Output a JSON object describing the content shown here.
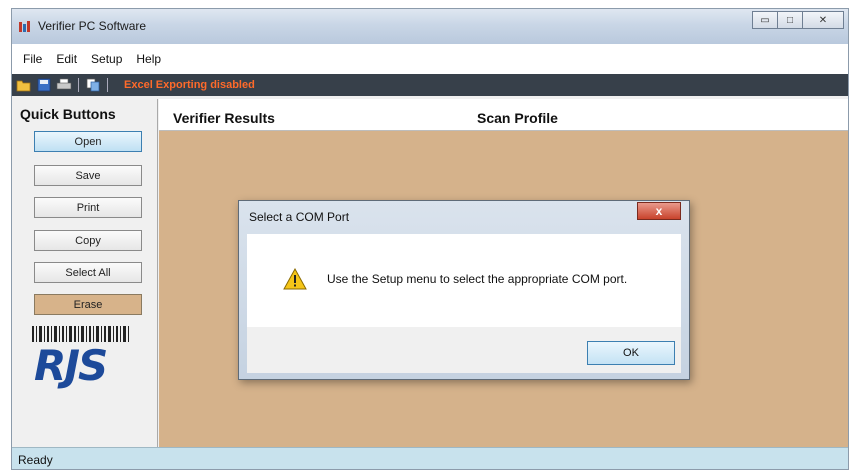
{
  "window": {
    "title": "Verifier PC Software",
    "minimize_glyph": "▭",
    "maximize_glyph": "□",
    "close_glyph": "✕"
  },
  "menu": {
    "items": [
      "File",
      "Edit",
      "Setup",
      "Help"
    ]
  },
  "toolbar": {
    "icons": [
      "open-folder-icon",
      "save-icon",
      "print-icon",
      "copy-icon"
    ],
    "status": "Excel Exporting disabled",
    "status_color": "#ff6a2a"
  },
  "quick_panel": {
    "title": "Quick Buttons",
    "buttons": [
      "Open",
      "Save",
      "Print",
      "Copy",
      "Select All",
      "Erase"
    ],
    "logo_text": "RJS",
    "logo_color": "#1d4a9a"
  },
  "results": {
    "col1": "Verifier Results",
    "col2": "Scan Profile",
    "background": "#d5b28b"
  },
  "dialog": {
    "title": "Select a COM Port",
    "close_glyph": "x",
    "message": "Use the Setup menu to select the appropriate COM port.",
    "ok_label": "OK",
    "icon": "warning-icon"
  },
  "status_bar": {
    "text": "Ready"
  }
}
